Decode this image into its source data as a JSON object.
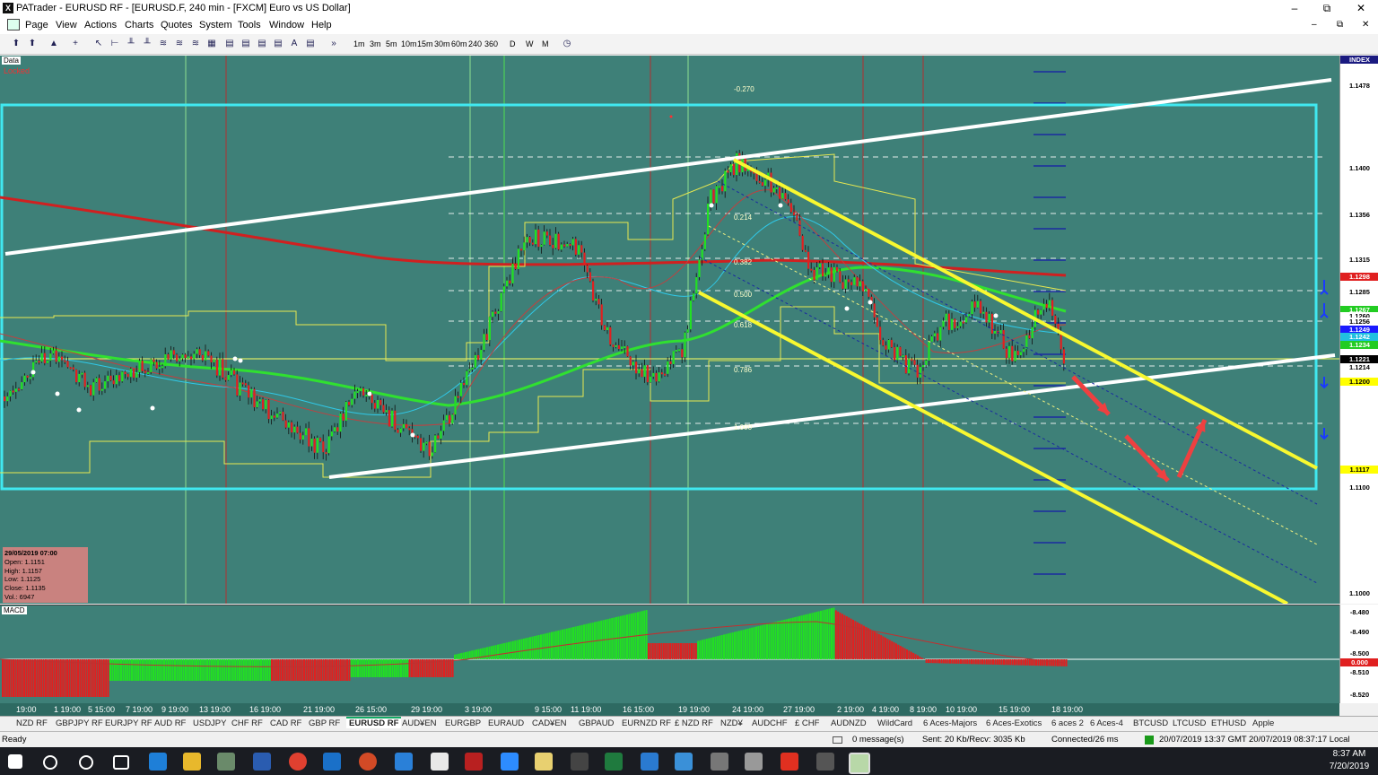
{
  "window": {
    "title": "PATrader - EURUSD RF - [EURUSD.F, 240 min - [FXCM] Euro vs US Dollar]",
    "minimize": "–",
    "maximize": "⧉",
    "close": "✕"
  },
  "menu": [
    "Page",
    "View",
    "Actions",
    "Charts",
    "Quotes",
    "System",
    "Tools",
    "Window",
    "Help"
  ],
  "timeframes": [
    "1m",
    "3m",
    "5m",
    "10m",
    "15m",
    "30m",
    "60m",
    "240",
    "360"
  ],
  "periods": [
    "D",
    "W",
    "M"
  ],
  "chart": {
    "data_label": "Data",
    "locked_label": "Locked",
    "index_label": "INDEX",
    "fib_levels": [
      "-0.270",
      "0.214",
      "0.382",
      "0.500",
      "0.618",
      "0.786",
      "1.000"
    ],
    "price_labels": [
      {
        "v": "1.1478",
        "c": "#ffffff",
        "fg": "#000"
      },
      {
        "v": "1.1400",
        "c": "#ffffff",
        "fg": "#000"
      },
      {
        "v": "1.1356",
        "c": "#ffffff",
        "fg": "#000"
      },
      {
        "v": "1.1315",
        "c": "#ffffff",
        "fg": "#000"
      },
      {
        "v": "1.1298",
        "c": "#e02020",
        "fg": "#fff"
      },
      {
        "v": "1.1285",
        "c": "#ffffff",
        "fg": "#000"
      },
      {
        "v": "1.1267",
        "c": "#22cc22",
        "fg": "#fff"
      },
      {
        "v": "1.1260",
        "c": "#ffffff",
        "fg": "#000"
      },
      {
        "v": "1.1256",
        "c": "#ffffff",
        "fg": "#000"
      },
      {
        "v": "1.1249",
        "c": "#1a1aff",
        "fg": "#fff"
      },
      {
        "v": "1.1242",
        "c": "#20c0e0",
        "fg": "#fff"
      },
      {
        "v": "1.1234",
        "c": "#22cc22",
        "fg": "#fff"
      },
      {
        "v": "1.1221",
        "c": "#000000",
        "fg": "#fff"
      },
      {
        "v": "1.1214",
        "c": "#ffffff",
        "fg": "#000"
      },
      {
        "v": "1.1200",
        "c": "#ffff00",
        "fg": "#000"
      },
      {
        "v": "1.1117",
        "c": "#ffff00",
        "fg": "#000"
      },
      {
        "v": "1.1100",
        "c": "#ffffff",
        "fg": "#000"
      },
      {
        "v": "1.1000",
        "c": "#ffffff",
        "fg": "#000"
      }
    ],
    "infobox": {
      "date": "29/05/2019 07:00",
      "open": "Open: 1.1151",
      "high": "High: 1.1157",
      "low": "Low: 1.1125",
      "close": "Close: 1.1135",
      "vol": "Vol.: 6947"
    }
  },
  "macd": {
    "label": "MACD",
    "scale": [
      "-8.480",
      "-8.490",
      "-8.500",
      "0.000",
      "-8.510",
      "-8.520"
    ]
  },
  "time_labels": [
    "19:00",
    "1 19:00",
    "5 15:00",
    "7 19:00",
    "9 19:00",
    "13 19:00",
    "16 19:00",
    "21 19:00",
    "26 15:00",
    "29 19:00",
    "3 19:00",
    "9 15:00",
    "11 19:00",
    "16 15:00",
    "19 19:00",
    "24 19:00",
    "27 19:00",
    "2 19:00",
    "4 19:00",
    "8 19:00",
    "10 19:00",
    "15 19:00",
    "18 19:00"
  ],
  "tabs": [
    "NZD RF",
    "GBPJPY RF",
    "EURJPY RF",
    "AUD RF",
    "USDJPY",
    "CHF RF",
    "CAD RF",
    "GBP RF",
    "EURUSD RF",
    "AUD¥EN",
    "EURGBP",
    "EURAUD",
    "CAD¥EN",
    "GBPAUD",
    "EURNZD RF",
    "£ NZD RF",
    "NZD¥",
    "AUDCHF",
    "£ CHF",
    "AUDNZD",
    "WildCard",
    "6 Aces-Majors",
    "6 Aces-Exotics",
    "6 aces 2",
    "6 Aces-4",
    "BTCUSD",
    "LTCUSD",
    "ETHUSD",
    "Apple"
  ],
  "active_tab": "EURUSD RF",
  "status": {
    "ready": "Ready",
    "messages": "0 message(s)",
    "sent": "Sent: 20 Kb/Recv: 3035 Kb",
    "connected": "Connected/26 ms",
    "gmt": "20/07/2019 13:37 GMT",
    "local": "20/07/2019 08:37:17 Local"
  },
  "taskbar": {
    "time": "8:37 AM",
    "date": "7/20/2019"
  }
}
